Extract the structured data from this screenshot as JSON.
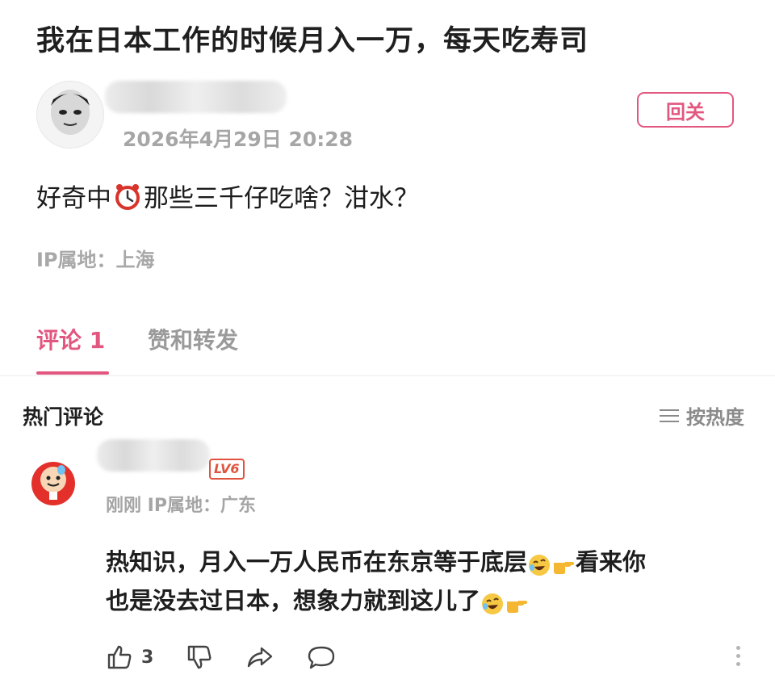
{
  "post": {
    "title": "我在日本工作的时候月入一万，每天吃寿司",
    "time": "2026年4月29日 20:28",
    "follow_label": "回关",
    "body_before": "好奇中",
    "body_after": "那些三千仔吃啥？泔水？",
    "ip": "IP属地：上海"
  },
  "tabs": [
    {
      "label": "评论 1",
      "active": true
    },
    {
      "label": "赞和转发",
      "active": false
    }
  ],
  "comments_section": {
    "title": "热门评论",
    "sort_label": "按热度"
  },
  "comment": {
    "level_badge": "LV6",
    "meta": "刚刚  IP属地：广东",
    "line1": "热知识，月入一万人民币在东京等于底层",
    "line1_tail": "看来你",
    "line2": "也是没去过日本，想象力就到这儿了",
    "like_count": "3"
  },
  "colors": {
    "accent": "#e2577f",
    "level": "#e0533f",
    "muted": "#a6a6a6"
  },
  "icons": [
    "alarm-clock-icon",
    "rofl-emoji-icon",
    "pointing-right-icon",
    "thumbs-up-icon",
    "thumbs-down-icon",
    "share-icon",
    "comment-icon",
    "more-icon",
    "sort-icon"
  ]
}
